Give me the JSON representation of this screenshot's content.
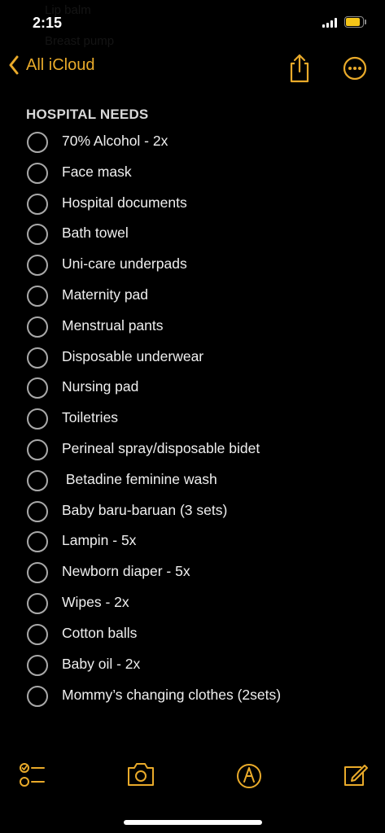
{
  "status_bar": {
    "time": "2:15",
    "background_text": [
      "Lip balm",
      "Breast pump"
    ]
  },
  "nav": {
    "back_label": "All iCloud",
    "share_icon": "share-icon",
    "more_icon": "ellipsis-circle-icon"
  },
  "note": {
    "title": "HOSPITAL NEEDS",
    "items": [
      {
        "label": "70% Alcohol - 2x",
        "checked": false
      },
      {
        "label": "Face mask",
        "checked": false
      },
      {
        "label": "Hospital documents",
        "checked": false
      },
      {
        "label": "Bath towel",
        "checked": false
      },
      {
        "label": "Uni-care underpads",
        "checked": false
      },
      {
        "label": "Maternity pad",
        "checked": false
      },
      {
        "label": "Menstrual pants",
        "checked": false
      },
      {
        "label": "Disposable underwear",
        "checked": false
      },
      {
        "label": "Nursing pad",
        "checked": false
      },
      {
        "label": "Toiletries",
        "checked": false
      },
      {
        "label": "Perineal spray/disposable bidet",
        "checked": false
      },
      {
        "label": " Betadine feminine wash",
        "checked": false
      },
      {
        "label": "Baby baru-baruan (3 sets)",
        "checked": false
      },
      {
        "label": "Lampin - 5x",
        "checked": false
      },
      {
        "label": "Newborn diaper - 5x",
        "checked": false
      },
      {
        "label": "Wipes - 2x",
        "checked": false
      },
      {
        "label": "Cotton balls",
        "checked": false
      },
      {
        "label": "Baby oil - 2x",
        "checked": false
      },
      {
        "label": "Mommy’s changing clothes (2sets)",
        "checked": false
      }
    ]
  },
  "toolbar": {
    "icons": [
      "checklist-icon",
      "camera-icon",
      "markup-pen-icon",
      "compose-icon"
    ]
  },
  "colors": {
    "accent": "#e9aa2a",
    "background": "#000000",
    "text": "#efefef",
    "checkbox": "#a9a9a9"
  }
}
